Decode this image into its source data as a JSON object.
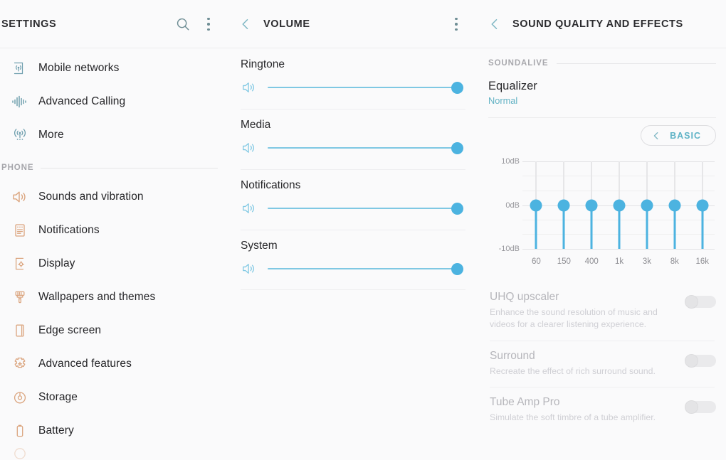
{
  "settings_panel": {
    "title": "SETTINGS",
    "search_icon": "search-icon",
    "more_icon": "more-vertical-icon",
    "items": [
      {
        "label": "Mobile networks",
        "icon": "mobile-networks-icon",
        "tone": "teal"
      },
      {
        "label": "Advanced Calling",
        "icon": "advanced-calling-icon",
        "tone": "teal"
      },
      {
        "label": "More",
        "icon": "more-connections-icon",
        "tone": "teal"
      }
    ],
    "section": {
      "label": "PHONE"
    },
    "phone_items": [
      {
        "label": "Sounds and vibration",
        "icon": "speaker-icon",
        "tone": "salmon"
      },
      {
        "label": "Notifications",
        "icon": "notifications-icon",
        "tone": "salmon"
      },
      {
        "label": "Display",
        "icon": "display-icon",
        "tone": "salmon"
      },
      {
        "label": "Wallpapers and themes",
        "icon": "paintbrush-icon",
        "tone": "salmon"
      },
      {
        "label": "Edge screen",
        "icon": "edge-screen-icon",
        "tone": "salmon"
      },
      {
        "label": "Advanced features",
        "icon": "advanced-features-icon",
        "tone": "salmon"
      },
      {
        "label": "Storage",
        "icon": "storage-icon",
        "tone": "salmon"
      },
      {
        "label": "Battery",
        "icon": "battery-icon",
        "tone": "salmon"
      }
    ]
  },
  "volume_panel": {
    "title": "VOLUME",
    "back_icon": "back-chevron-icon",
    "more_icon": "more-vertical-icon",
    "sliders": [
      {
        "label": "Ringtone",
        "icon": "speaker-icon",
        "value": 100
      },
      {
        "label": "Media",
        "icon": "speaker-icon",
        "value": 100
      },
      {
        "label": "Notifications",
        "icon": "speaker-icon",
        "value": 100
      },
      {
        "label": "System",
        "icon": "speaker-icon",
        "value": 100
      }
    ]
  },
  "sound_panel": {
    "title": "SOUND QUALITY AND EFFECTS",
    "back_icon": "back-chevron-icon",
    "section_label": "SOUNDALIVE",
    "equalizer": {
      "title": "Equalizer",
      "value": "Normal"
    },
    "mode_button": {
      "label": "BASIC",
      "icon": "back-chevron-icon"
    },
    "toggles": [
      {
        "title": "UHQ upscaler",
        "desc": "Enhance the sound resolution of music and videos for a clearer listening experience.",
        "state": "off"
      },
      {
        "title": "Surround",
        "desc": "Recreate the effect of rich surround sound.",
        "state": "off"
      },
      {
        "title": "Tube Amp Pro",
        "desc": "Simulate the soft timbre of a tube amplifier.",
        "state": "off"
      }
    ]
  },
  "chart_data": {
    "type": "bar",
    "title": "Equalizer",
    "categories": [
      "60",
      "150",
      "400",
      "1k",
      "3k",
      "8k",
      "16k"
    ],
    "values": [
      0,
      0,
      0,
      0,
      0,
      0,
      0
    ],
    "xlabel": "",
    "ylabel": "dB",
    "ylim": [
      -10,
      10
    ],
    "ytick_labels": [
      "10dB",
      "0dB",
      "-10dB"
    ],
    "ytick_values": [
      10,
      0,
      -10
    ],
    "grid": true,
    "legend": false,
    "accent_color": "#4cb3e0"
  },
  "colors": {
    "accent_blue": "#4cb3e0",
    "accent_teal": "#62b2c4",
    "icon_teal": "#6f9fae",
    "icon_salmon": "#dba57f",
    "text_primary": "#28282b",
    "text_muted": "#a6a6ab",
    "background": "#fafafb"
  }
}
